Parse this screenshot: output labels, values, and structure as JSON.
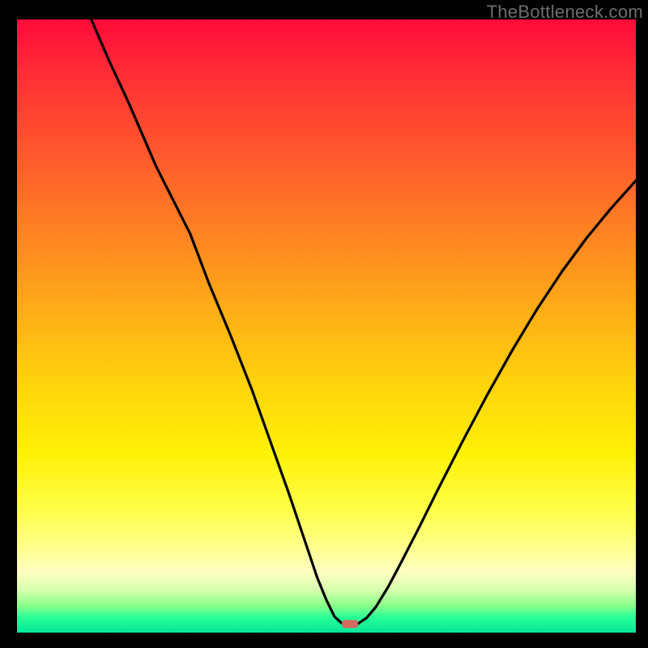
{
  "watermark": "TheBottleneck.com",
  "chart_data": {
    "type": "line",
    "title": "",
    "xlabel": "",
    "ylabel": "",
    "xlim": [
      0,
      100
    ],
    "ylim": [
      0,
      100
    ],
    "grid": false,
    "legend": false,
    "marker": {
      "x": 53.8,
      "y": 1.4
    },
    "points": [
      {
        "x": 12.0,
        "y": 100.0
      },
      {
        "x": 15.0,
        "y": 93.0
      },
      {
        "x": 18.0,
        "y": 86.5
      },
      {
        "x": 22.5,
        "y": 76.0
      },
      {
        "x": 25.0,
        "y": 71.0
      },
      {
        "x": 28.0,
        "y": 65.0
      },
      {
        "x": 31.0,
        "y": 57.0
      },
      {
        "x": 34.5,
        "y": 48.5
      },
      {
        "x": 38.0,
        "y": 39.5
      },
      {
        "x": 41.0,
        "y": 31.0
      },
      {
        "x": 44.0,
        "y": 22.5
      },
      {
        "x": 47.0,
        "y": 13.5
      },
      {
        "x": 48.5,
        "y": 9.0
      },
      {
        "x": 50.0,
        "y": 5.3
      },
      {
        "x": 51.3,
        "y": 2.6
      },
      {
        "x": 52.4,
        "y": 1.6
      },
      {
        "x": 53.4,
        "y": 1.4
      },
      {
        "x": 55.0,
        "y": 1.4
      },
      {
        "x": 56.5,
        "y": 2.4
      },
      {
        "x": 58.0,
        "y": 4.2
      },
      {
        "x": 60.0,
        "y": 7.5
      },
      {
        "x": 62.0,
        "y": 11.3
      },
      {
        "x": 65.0,
        "y": 17.2
      },
      {
        "x": 68.0,
        "y": 23.3
      },
      {
        "x": 72.0,
        "y": 31.2
      },
      {
        "x": 76.0,
        "y": 38.8
      },
      {
        "x": 80.0,
        "y": 46.0
      },
      {
        "x": 84.0,
        "y": 52.7
      },
      {
        "x": 88.0,
        "y": 58.8
      },
      {
        "x": 92.0,
        "y": 64.3
      },
      {
        "x": 96.0,
        "y": 69.2
      },
      {
        "x": 100.0,
        "y": 73.7
      }
    ]
  }
}
